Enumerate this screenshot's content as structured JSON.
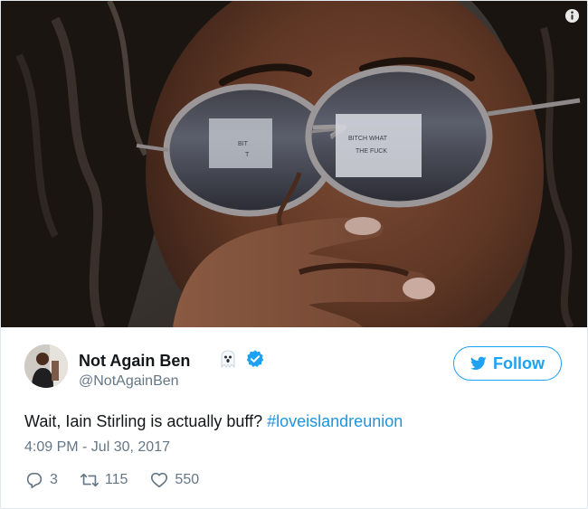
{
  "tweet": {
    "author_name": "Not Again Ben",
    "author_handle": "@NotAgainBen",
    "follow_label": "Follow",
    "text_plain": "Wait, Iain Stirling is actually buff? ",
    "hashtag": "#loveislandreunion",
    "timestamp": "4:09 PM - Jul 30, 2017",
    "reply_count": "3",
    "retweet_count": "115",
    "like_count": "550"
  },
  "photo": {
    "lens_left_text": [
      "BIT",
      "T"
    ],
    "lens_right_text": [
      "BITCH WHAT",
      "THE FUCK"
    ]
  },
  "colors": {
    "accent": "#1da1f2",
    "link": "#1b95e0",
    "muted": "#657786",
    "text": "#14171a"
  },
  "icons": [
    "info-icon",
    "ghost-emoji-icon",
    "verified-badge-icon",
    "twitter-bird-icon",
    "reply-icon",
    "retweet-icon",
    "like-icon"
  ]
}
